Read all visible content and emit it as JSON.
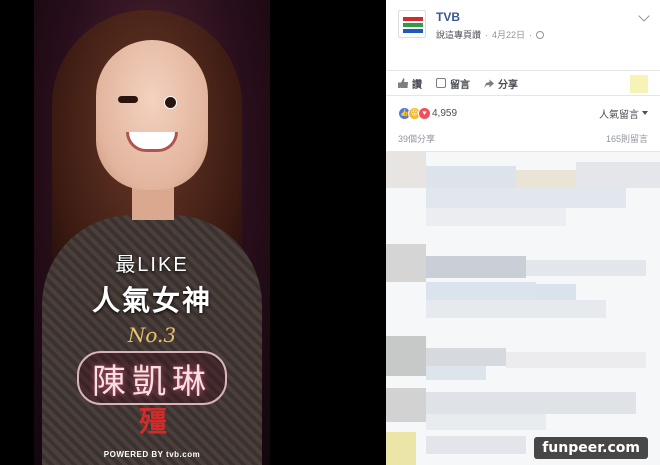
{
  "poster": {
    "line1": "最LIKE",
    "line2": "人氣女神",
    "rank": "No.3",
    "name": "陳凱琳",
    "seal": "殭",
    "powered_by": "POWERED BY tvb.com"
  },
  "post": {
    "page_name": "TVB",
    "posted_by": "說這專頁讚",
    "date": "4月22日",
    "icon_globe": "globe-icon"
  },
  "actions": {
    "like": "讚",
    "comment": "留言",
    "share": "分享"
  },
  "reactions": {
    "count": "4,959",
    "sort_label": "人氣留言"
  },
  "counts": {
    "shares": "39個分享",
    "comments": "165則留言"
  },
  "watermark": "funpeer.com",
  "colors": {
    "link_blue": "#365899",
    "like_blue": "#4a7ae0",
    "love_red": "#f04f5e",
    "wow_yellow": "#f7b928",
    "tvb_red": "#d32b2b",
    "tvb_green": "#2e9b47",
    "tvb_blue": "#1e5bb8"
  }
}
